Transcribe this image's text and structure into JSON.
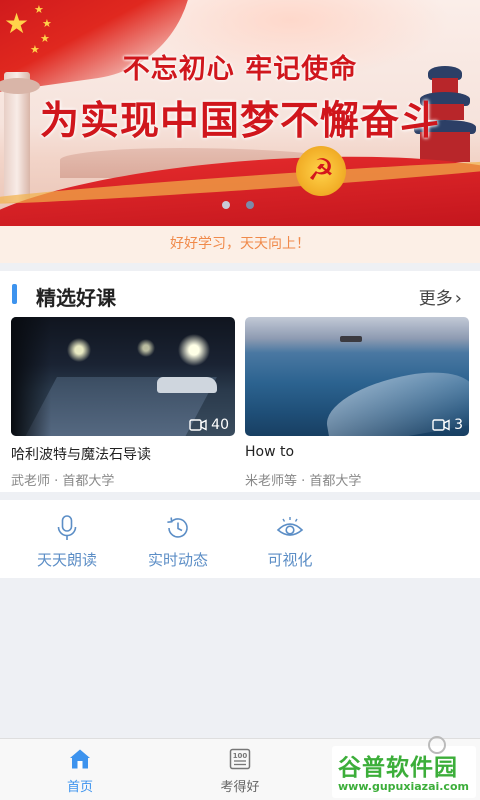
{
  "banner": {
    "slogan_line1": "不忘初心 牢记使命",
    "slogan_line2": "为实现中国梦不懈奋斗",
    "carousel_total": 2,
    "carousel_active": 2
  },
  "motto": "好好学习，天天向上！",
  "featured": {
    "title": "精选好课",
    "more_label": "更多",
    "courses": [
      {
        "title": "哈利波特与魔法石导读",
        "meta": "武老师 · 首都大学",
        "video_count": "40"
      },
      {
        "title": "How to",
        "meta": "米老师等 · 首都大学",
        "video_count": "3"
      }
    ]
  },
  "quick_actions": [
    {
      "label": "天天朗读",
      "icon": "microphone-icon"
    },
    {
      "label": "实时动态",
      "icon": "history-icon"
    },
    {
      "label": "可视化",
      "icon": "eye-icon"
    }
  ],
  "tabbar": {
    "items": [
      {
        "label": "首页",
        "icon": "home-icon",
        "active": true
      },
      {
        "label": "考得好",
        "icon": "score-100-icon",
        "active": false
      }
    ]
  },
  "watermark": {
    "name": "谷普软件园",
    "url": "www.gupuxiazai.com"
  },
  "colors": {
    "accent": "#3d93ee",
    "quick_action_text": "#5c8ec6",
    "motto_text": "#f08a4b",
    "slogan_red": "#d0161c"
  }
}
